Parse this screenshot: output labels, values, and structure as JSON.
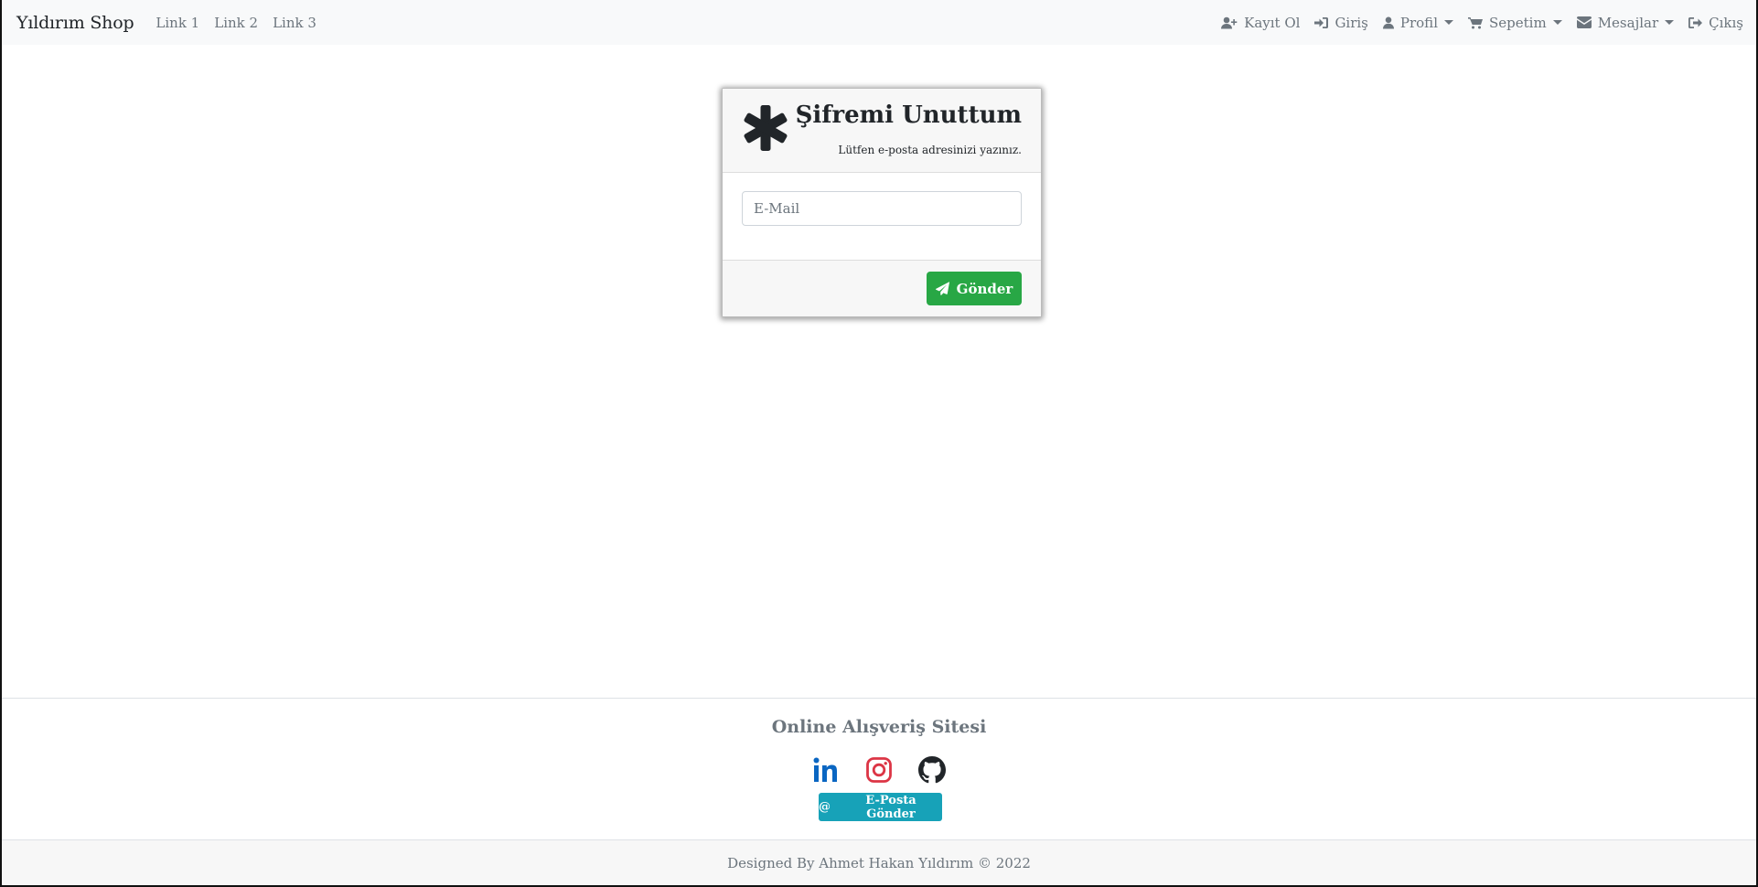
{
  "navbar": {
    "brand": "Yıldırım Shop",
    "links": [
      "Link 1",
      "Link 2",
      "Link 3"
    ],
    "right_items": [
      {
        "label": "Kayıt Ol",
        "icon": "user-plus-icon",
        "dropdown": false
      },
      {
        "label": "Giriş",
        "icon": "sign-in-icon",
        "dropdown": false
      },
      {
        "label": "Profil",
        "icon": "user-icon",
        "dropdown": true
      },
      {
        "label": "Sepetim",
        "icon": "cart-icon",
        "dropdown": true
      },
      {
        "label": "Mesajlar",
        "icon": "envelope-icon",
        "dropdown": true
      },
      {
        "label": "Çıkış",
        "icon": "sign-out-icon",
        "dropdown": false
      }
    ]
  },
  "card": {
    "icon": "asterisk-icon",
    "title": "Şifremi Unuttum",
    "subtitle": "Lütfen e-posta adresinizi yazınız.",
    "email_placeholder": "E-Mail",
    "email_value": "",
    "submit_label": "Gönder",
    "submit_icon": "paper-plane-icon"
  },
  "footer": {
    "title": "Online Alışveriş Sitesi",
    "social": [
      {
        "name": "linkedin-icon",
        "color": "#0a66c2"
      },
      {
        "name": "instagram-icon",
        "color": "#dc3545"
      },
      {
        "name": "github-icon",
        "color": "#212529"
      }
    ],
    "mail_button_label": "E-Posta Gönder",
    "mail_button_icon": "@",
    "copyright": "Designed By Ahmet Hakan Yıldırım © 2022"
  },
  "colors": {
    "success": "#28a745",
    "info": "#17a2b8",
    "muted": "#6c757d",
    "navbar_bg": "#f8f9fa"
  }
}
